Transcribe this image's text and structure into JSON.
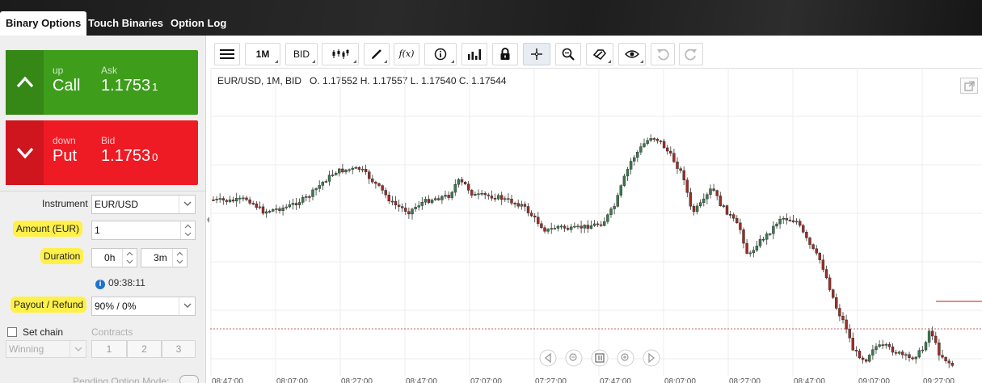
{
  "tabs": [
    {
      "label": "Binary Options",
      "active": true
    },
    {
      "label": "Touch Binaries",
      "active": false
    },
    {
      "label": "Option Log",
      "active": false
    }
  ],
  "call": {
    "direction": "up",
    "label": "Call",
    "price_label": "Ask",
    "price_main": "1.1753",
    "price_tail": "1"
  },
  "put": {
    "direction": "down",
    "label": "Put",
    "price_label": "Bid",
    "price_main": "1.1753",
    "price_tail": "0"
  },
  "form": {
    "instrument_label": "Instrument",
    "instrument_value": "EUR/USD",
    "amount_label": "Amount (EUR)",
    "amount_value": "1",
    "duration_label": "Duration",
    "duration_hours": "0",
    "duration_hours_unit": "h",
    "duration_minutes": "3",
    "duration_minutes_unit": "m",
    "expiry_time": "09:38:11",
    "payout_label": "Payout / Refund",
    "payout_value": "90% / 0%",
    "set_chain_label": "Set chain",
    "contracts_label": "Contracts",
    "chain_mode": "Winning",
    "contracts": [
      "1",
      "2",
      "3"
    ],
    "pending_label": "Pending Option Mode:"
  },
  "toolbar": {
    "timeframe": "1M",
    "price_type": "BID",
    "function_label": "f(x)"
  },
  "icons": [
    "menu-icon",
    "candles-icon",
    "pencil-icon",
    "info-icon",
    "bars-icon",
    "lock-icon",
    "crosshair-icon",
    "zoom-icon",
    "shapes-icon",
    "eye-icon",
    "undo-icon",
    "redo-icon",
    "popout-icon",
    "chevron-left-icon",
    "zoom-out-icon",
    "reset-icon",
    "zoom-in-icon",
    "chevron-right-icon"
  ],
  "chart": {
    "symbol_line": "EUR/USD, 1M, BID",
    "ohlc_line": "O. 1.17552 H. 1.17557 L. 1.17540 C. 1.17544"
  },
  "chart_data": {
    "type": "candlestick",
    "instrument": "EUR/USD",
    "timeframe": "1M",
    "price_type": "BID",
    "open": 1.17552,
    "high": 1.17557,
    "low": 1.1754,
    "close": 1.17544,
    "x_ticks": [
      "08:47:00",
      "08:07:00",
      "08:27:00",
      "08:47:00",
      "07:07:00",
      "07:27:00",
      "07:47:00",
      "08:07:00",
      "08:27:00",
      "08:47:00",
      "09:07:00",
      "09:27:00"
    ],
    "grid": true,
    "colors": {
      "up": "#3c7a4e",
      "down": "#9c2f27",
      "current_line": "#e06262"
    }
  },
  "colors": {
    "call_green": "#3e9e1c",
    "put_red": "#ee1b24",
    "highlight": "#fff04a"
  }
}
